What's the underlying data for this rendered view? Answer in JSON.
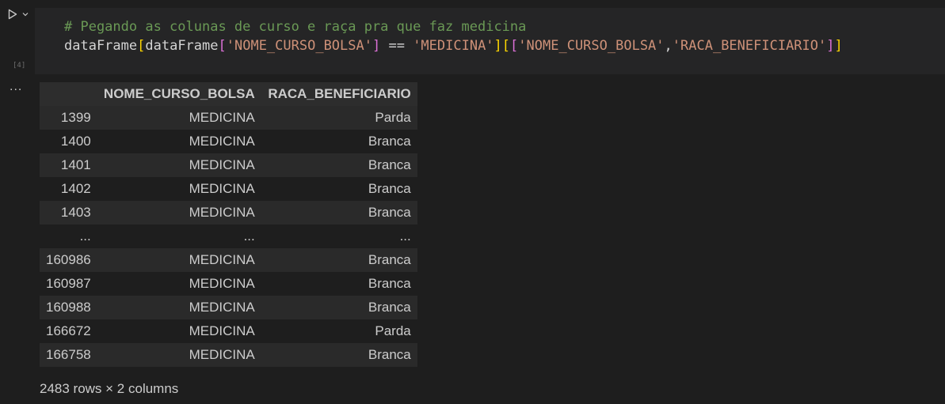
{
  "gutter": {
    "run_icon": "play-icon",
    "expand_icon": "chevron-down-icon",
    "exec_count": "[4]",
    "output_menu": "..."
  },
  "code": {
    "comment": "# Pegando as colunas de curso e raça pra que faz medicina",
    "line2": {
      "var1": "dataFrame",
      "var2": "dataFrame",
      "str_col": "'NOME_CURSO_BOLSA'",
      "op": " == ",
      "str_val": "'MEDICINA'",
      "str_sel1": "'NOME_CURSO_BOLSA'",
      "comma": ",",
      "str_sel2": "'RACA_BENEFICIARIO'"
    }
  },
  "table": {
    "headers": [
      "",
      "NOME_CURSO_BOLSA",
      "RACA_BENEFICIARIO"
    ],
    "rows": [
      [
        "1399",
        "MEDICINA",
        "Parda"
      ],
      [
        "1400",
        "MEDICINA",
        "Branca"
      ],
      [
        "1401",
        "MEDICINA",
        "Branca"
      ],
      [
        "1402",
        "MEDICINA",
        "Branca"
      ],
      [
        "1403",
        "MEDICINA",
        "Branca"
      ],
      [
        "...",
        "...",
        "..."
      ],
      [
        "160986",
        "MEDICINA",
        "Branca"
      ],
      [
        "160987",
        "MEDICINA",
        "Branca"
      ],
      [
        "160988",
        "MEDICINA",
        "Branca"
      ],
      [
        "166672",
        "MEDICINA",
        "Parda"
      ],
      [
        "166758",
        "MEDICINA",
        "Branca"
      ]
    ],
    "shape": "2483 rows × 2 columns"
  }
}
